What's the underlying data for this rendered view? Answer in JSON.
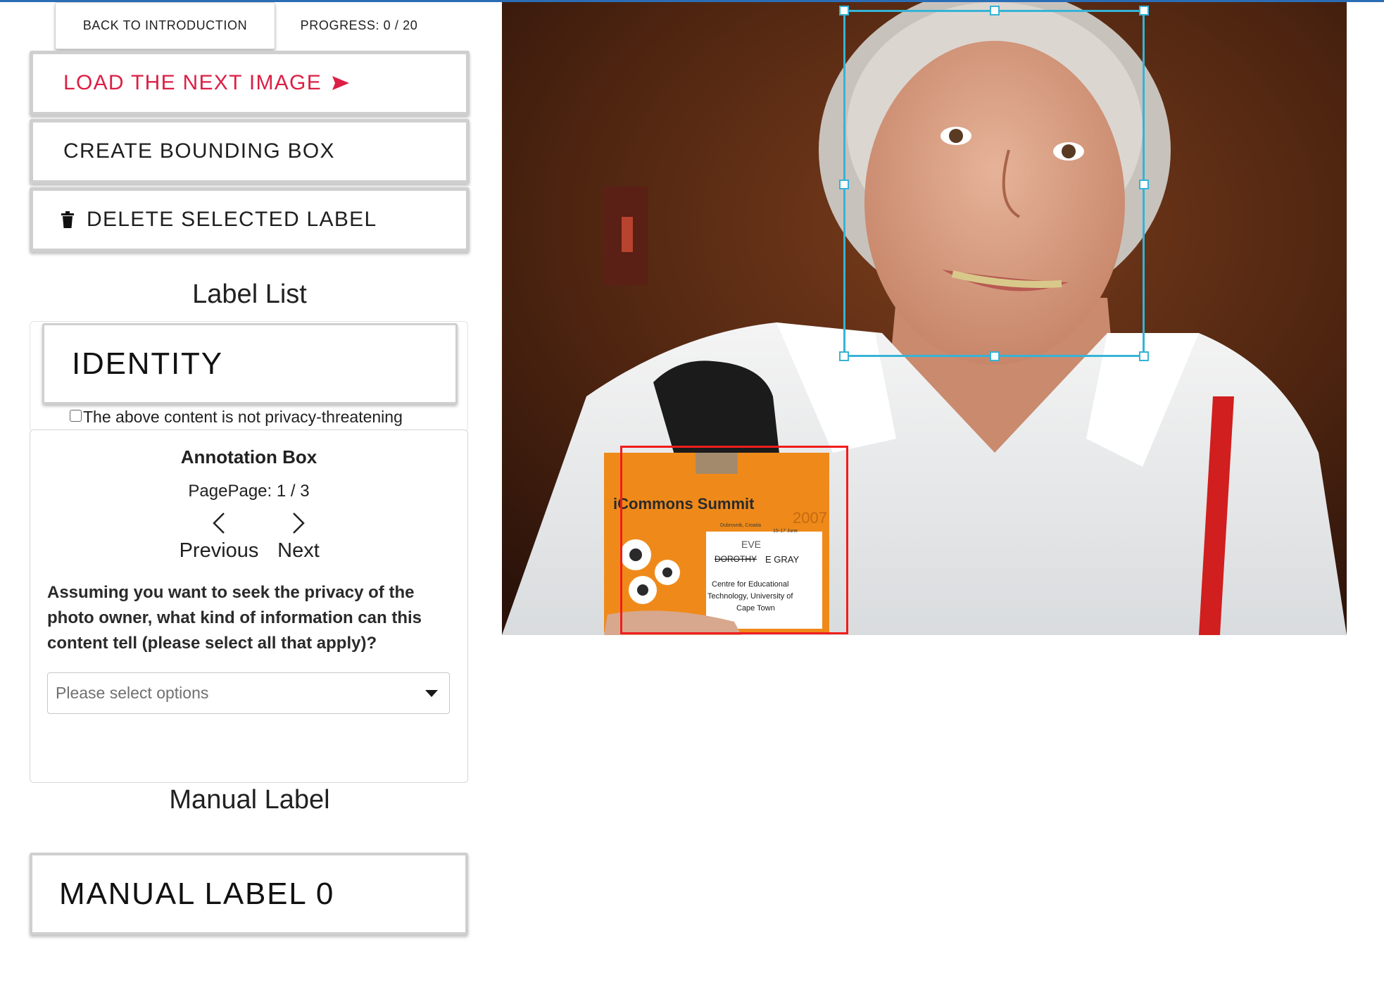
{
  "header": {
    "back_label": "BACK TO INTRODUCTION",
    "progress_label": "PROGRESS: 0 / 20"
  },
  "actions": {
    "next_image_label": "LOAD THE NEXT IMAGE",
    "create_box_label": "CREATE BOUNDING BOX",
    "delete_label": "DELETE SELECTED LABEL",
    "accent_color": "#dc1f45"
  },
  "label_list": {
    "title": "Label List",
    "items": [
      {
        "label": "IDENTITY"
      }
    ],
    "privacy_checkbox_label": "The above content is not privacy-threatening",
    "privacy_checked": false
  },
  "annotation": {
    "title": "Annotation Box",
    "page_indicator": "PagePage: 1 / 3",
    "prev_label": "Previous",
    "next_label": "Next",
    "question": "Assuming you want to seek the privacy of the photo owner, what kind of information can this content tell (please select all that apply)?",
    "select_placeholder": "Please select options"
  },
  "manual": {
    "title": "Manual Label",
    "items": [
      {
        "label": "MANUAL LABEL 0"
      }
    ]
  },
  "photo": {
    "badge_title": "iCommons Summit",
    "badge_year": "2007",
    "badge_place": "Dubrovnik, Croatia",
    "badge_date": "15-17 June",
    "badge_handwritten": "EVE",
    "badge_name_struck": "DOROTHY",
    "badge_name": "E GRAY",
    "badge_org_1": "Centre for Educational",
    "badge_org_2": "Technology, University of",
    "badge_org_3": "Cape Town",
    "selected_box_color": "#36b3d6",
    "other_box_color": "#f01d1d"
  }
}
